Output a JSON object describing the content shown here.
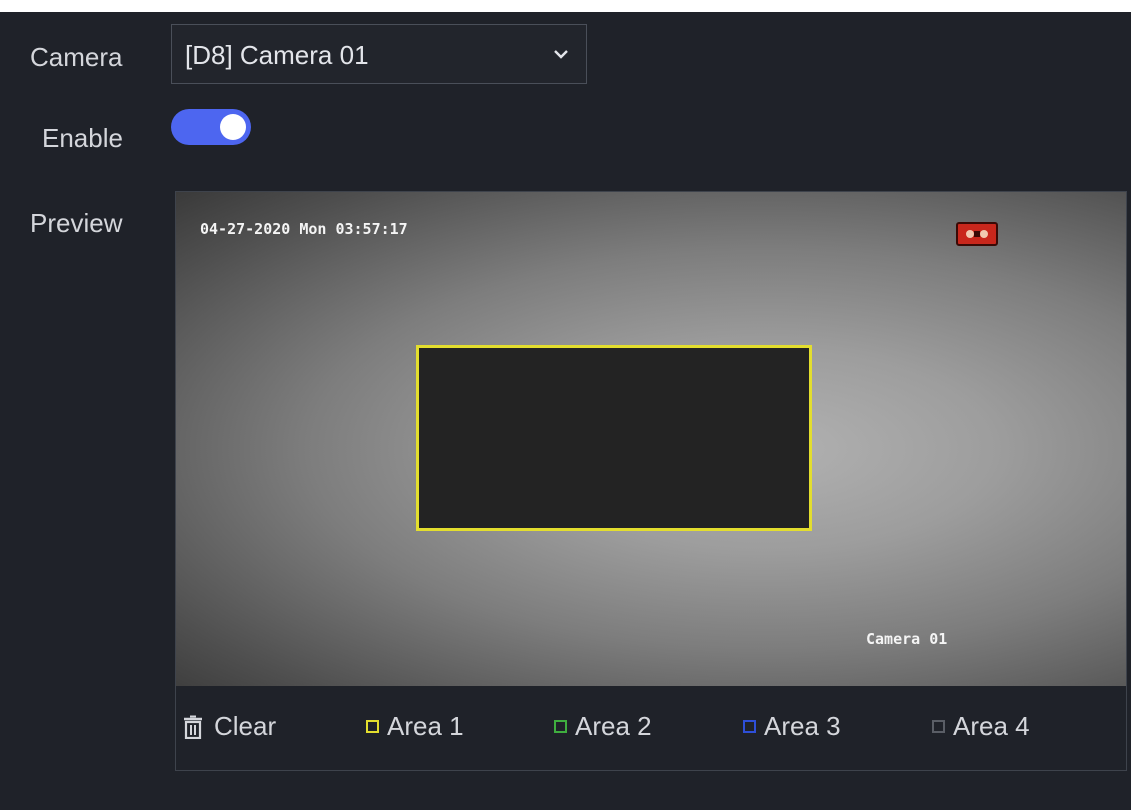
{
  "form": {
    "camera_label": "Camera",
    "camera_value": "[D8] Camera 01",
    "enable_label": "Enable",
    "enable_on": true,
    "preview_label": "Preview"
  },
  "video": {
    "timestamp": "04-27-2020 Mon 03:57:17",
    "camera_name": "Camera 01",
    "record_icon": "record-indicator-icon",
    "mask_color": "#e3de2e"
  },
  "toolbar": {
    "clear_label": "Clear",
    "clear_icon": "trash-icon",
    "areas": [
      {
        "label": "Area 1",
        "color": "#e3de2e"
      },
      {
        "label": "Area 2",
        "color": "#3fae3f"
      },
      {
        "label": "Area 3",
        "color": "#2e4fd8"
      },
      {
        "label": "Area 4",
        "color": "#5a5e66"
      }
    ]
  },
  "colors": {
    "background": "#1f2229",
    "accent": "#4d66f0"
  }
}
